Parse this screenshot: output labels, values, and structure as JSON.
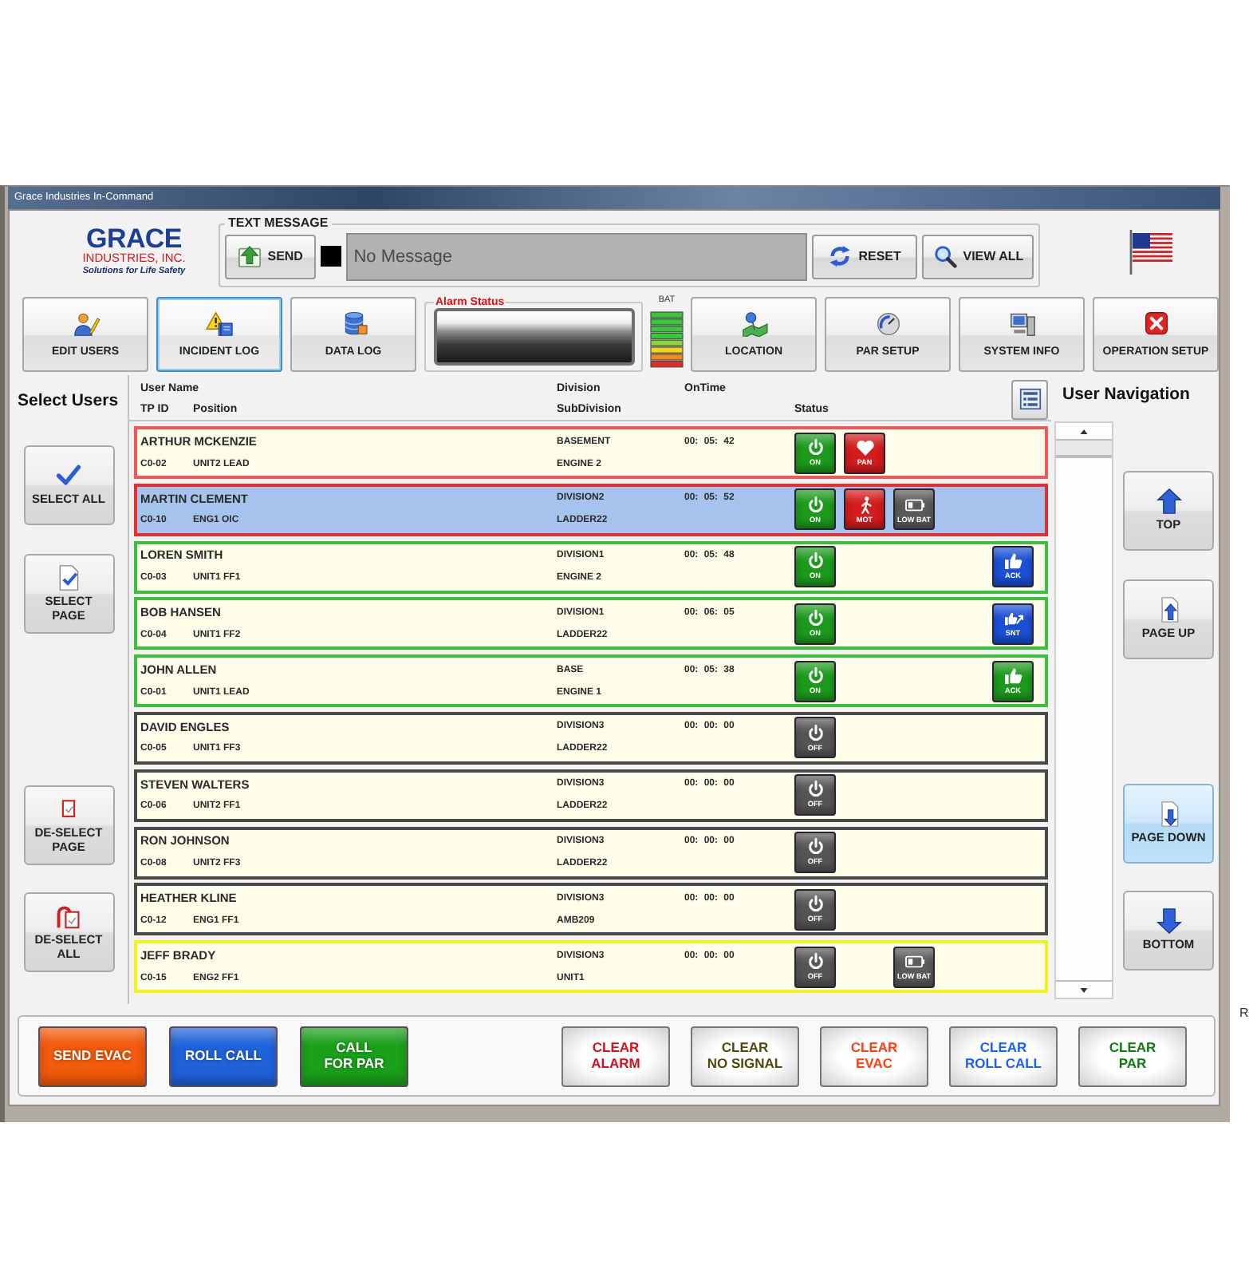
{
  "window": {
    "title": "Grace Industries In-Command"
  },
  "logo": {
    "wordmark": "GRACE",
    "company": "INDUSTRIES, INC.",
    "tagline": "Solutions for Life Safety"
  },
  "text_message": {
    "label": "TEXT MESSAGE",
    "send_button": "SEND",
    "placeholder": "No Message",
    "reset_button": "RESET",
    "view_all_button": "VIEW ALL"
  },
  "toolbar_left": [
    {
      "label": "EDIT USERS",
      "selected": false
    },
    {
      "label": "INCIDENT LOG",
      "selected": true
    },
    {
      "label": "DATA LOG",
      "selected": false
    }
  ],
  "alarm_status": {
    "label": "Alarm Status"
  },
  "battery_meter": {
    "label": "BAT"
  },
  "toolbar_right": [
    {
      "label": "LOCATION",
      "selected": false
    },
    {
      "label": "PAR SETUP",
      "selected": false
    },
    {
      "label": "SYSTEM INFO",
      "selected": false
    },
    {
      "label": "OPERATION SETUP",
      "selected": false
    }
  ],
  "select_users": {
    "title": "Select Users",
    "buttons": [
      "SELECT ALL",
      "SELECT\nPAGE",
      "DE-SELECT\nPAGE",
      "DE-SELECT\nALL"
    ]
  },
  "table": {
    "columns": {
      "user_name": "User Name",
      "tp_id": "TP ID",
      "position": "Position",
      "division": "Division",
      "subdivision": "SubDivision",
      "on_time": "OnTime",
      "status": "Status"
    },
    "rows": [
      {
        "name": "ARTHUR MCKENZIE",
        "tp_id": "C0-02",
        "position": "UNIT2 LEAD",
        "division": "BASEMENT",
        "subdivision": "ENGINE 2",
        "on_time": "00: 05: 42",
        "color": "#f05858",
        "selected": false,
        "statuses": [
          {
            "kind": "power",
            "label": "ON",
            "color": "#1c9a1c"
          },
          {
            "kind": "panic",
            "label": "PAN",
            "color": "#d41c1c"
          }
        ]
      },
      {
        "name": "MARTIN CLEMENT",
        "tp_id": "C0-10",
        "position": "ENG1 OIC",
        "division": "DIVISION2",
        "subdivision": "LADDER22",
        "on_time": "00: 05: 52",
        "color": "#e53030",
        "selected": true,
        "statuses": [
          {
            "kind": "power",
            "label": "ON",
            "color": "#1c9a1c"
          },
          {
            "kind": "motion",
            "label": "MOT",
            "color": "#d41c1c"
          },
          {
            "kind": "battery",
            "label": "LOW BAT",
            "color": "#5a5a5a"
          }
        ]
      },
      {
        "name": "LOREN SMITH",
        "tp_id": "C0-03",
        "position": "UNIT1 FF1",
        "division": "DIVISION1",
        "subdivision": "ENGINE 2",
        "on_time": "00: 05: 48",
        "color": "#3cc03c",
        "selected": false,
        "statuses": [
          {
            "kind": "power",
            "label": "ON",
            "color": "#1c9a1c"
          },
          {
            "kind": "ack",
            "label": "ACK",
            "color": "#1a4fd6"
          }
        ]
      },
      {
        "name": "BOB HANSEN",
        "tp_id": "C0-04",
        "position": "UNIT1 FF2",
        "division": "DIVISION1",
        "subdivision": "LADDER22",
        "on_time": "00: 06: 05",
        "color": "#3cc03c",
        "selected": false,
        "statuses": [
          {
            "kind": "power",
            "label": "ON",
            "color": "#1c9a1c"
          },
          {
            "kind": "sent",
            "label": "SNT",
            "color": "#1a4fd6"
          }
        ]
      },
      {
        "name": "JOHN ALLEN",
        "tp_id": "C0-01",
        "position": "UNIT1 LEAD",
        "division": "BASE",
        "subdivision": "ENGINE 1",
        "on_time": "00: 05: 38",
        "color": "#3cc03c",
        "selected": false,
        "statuses": [
          {
            "kind": "power",
            "label": "ON",
            "color": "#1c9a1c"
          },
          {
            "kind": "ack",
            "label": "ACK",
            "color": "#1c9a1c"
          }
        ]
      },
      {
        "name": "DAVID ENGLES",
        "tp_id": "C0-05",
        "position": "UNIT1 FF3",
        "division": "DIVISION3",
        "subdivision": "LADDER22",
        "on_time": "00: 00: 00",
        "color": "#4a4a4a",
        "selected": false,
        "statuses": [
          {
            "kind": "power",
            "label": "OFF",
            "color": "#555555"
          }
        ]
      },
      {
        "name": "STEVEN WALTERS",
        "tp_id": "C0-06",
        "position": "UNIT2 FF1",
        "division": "DIVISION3",
        "subdivision": "LADDER22",
        "on_time": "00: 00: 00",
        "color": "#4a4a4a",
        "selected": false,
        "statuses": [
          {
            "kind": "power",
            "label": "OFF",
            "color": "#555555"
          }
        ]
      },
      {
        "name": "RON JOHNSON",
        "tp_id": "C0-08",
        "position": "UNIT2 FF3",
        "division": "DIVISION3",
        "subdivision": "LADDER22",
        "on_time": "00: 00: 00",
        "color": "#4a4a4a",
        "selected": false,
        "statuses": [
          {
            "kind": "power",
            "label": "OFF",
            "color": "#555555"
          }
        ]
      },
      {
        "name": "HEATHER KLINE",
        "tp_id": "C0-12",
        "position": "ENG1 FF1",
        "division": "DIVISION3",
        "subdivision": "AMB209",
        "on_time": "00: 00: 00",
        "color": "#4a4a4a",
        "selected": false,
        "statuses": [
          {
            "kind": "power",
            "label": "OFF",
            "color": "#555555"
          }
        ]
      },
      {
        "name": "JEFF BRADY",
        "tp_id": "C0-15",
        "position": "ENG2 FF1",
        "division": "DIVISION3",
        "subdivision": "UNIT1",
        "on_time": "00: 00: 00",
        "color": "#f2f21e",
        "selected": false,
        "statuses": [
          {
            "kind": "power",
            "label": "OFF",
            "color": "#555555"
          },
          {
            "kind": "battery",
            "label": "LOW BAT",
            "color": "#5a5a5a"
          }
        ]
      }
    ]
  },
  "user_navigation": {
    "title": "User Navigation",
    "buttons": [
      {
        "label": "TOP",
        "selected": false
      },
      {
        "label": "PAGE UP",
        "selected": false
      },
      {
        "label": "PAGE DOWN",
        "selected": true
      },
      {
        "label": "BOTTOM",
        "selected": false
      }
    ]
  },
  "actions": [
    {
      "label": "SEND EVAC",
      "kind": "filled",
      "color": "#f25a0c"
    },
    {
      "label": "ROLL CALL",
      "kind": "filled",
      "color": "#1f63d9"
    },
    {
      "label": "CALL\nFOR PAR",
      "kind": "filled",
      "color": "#1aa01a"
    },
    {
      "label": "CLEAR\nALARM",
      "kind": "clear",
      "color": "#d4101c"
    },
    {
      "label": "CLEAR\nNO SIGNAL",
      "kind": "clear",
      "color": "#4f4a0a"
    },
    {
      "label": "CLEAR\nEVAC",
      "kind": "clear",
      "color": "#ff3d0d"
    },
    {
      "label": "CLEAR\nROLL CALL",
      "kind": "clear",
      "color": "#1660ff"
    },
    {
      "label": "CLEAR\nPAR",
      "kind": "clear",
      "color": "#0e7a12"
    }
  ],
  "edge_text": "R"
}
